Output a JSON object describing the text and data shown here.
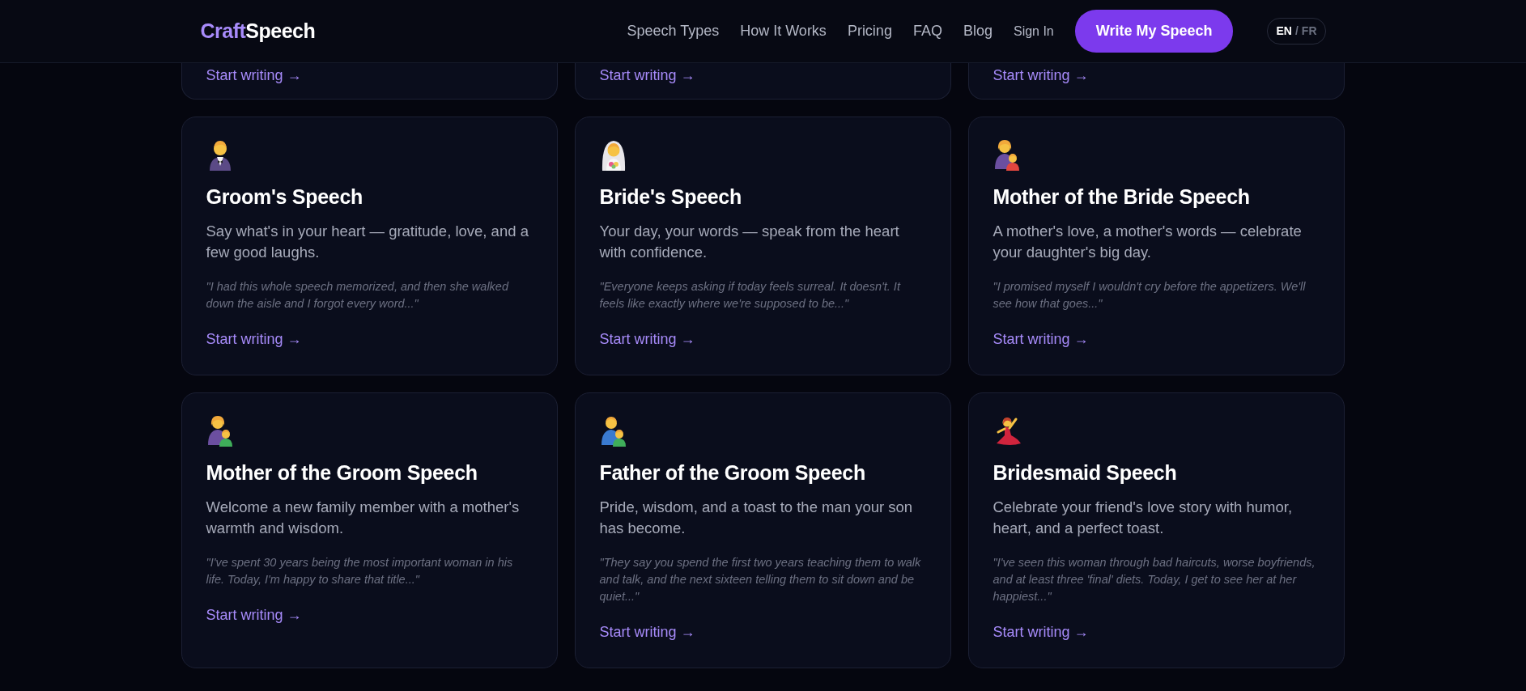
{
  "header": {
    "logo": {
      "accent": "Craft",
      "rest": "Speech"
    },
    "nav_links": [
      "Speech Types",
      "How It Works",
      "Pricing",
      "FAQ",
      "Blog"
    ],
    "sign_in": "Sign In",
    "cta": "Write My Speech",
    "language": {
      "options": [
        {
          "label": "EN",
          "selected": true
        },
        {
          "label": "FR",
          "selected": false
        }
      ],
      "separator": "/"
    }
  },
  "partial_cards": [
    {
      "link": "Start writing →"
    },
    {
      "link": "Start writing →"
    },
    {
      "link": "Start writing →"
    }
  ],
  "cards": [
    {
      "title": "Groom's Speech",
      "description": "Say what's in your heart — gratitude, love, and a few good laughs.",
      "quote": "\"I had this whole speech memorized, and then she walked down the aisle and I forgot every word...\"",
      "link": "Start writing →"
    },
    {
      "title": "Bride's Speech",
      "description": "Your day, your words — speak from the heart with confidence.",
      "quote": "\"Everyone keeps asking if today feels surreal. It doesn't. It feels like exactly where we're supposed to be...\"",
      "link": "Start writing →"
    },
    {
      "title": "Mother of the Bride Speech",
      "description": "A mother's love, a mother's words — celebrate your daughter's big day.",
      "quote": "\"I promised myself I wouldn't cry before the appetizers. We'll see how that goes...\"",
      "link": "Start writing →"
    },
    {
      "title": "Mother of the Groom Speech",
      "description": "Welcome a new family member with a mother's warmth and wisdom.",
      "quote": "\"I've spent 30 years being the most important woman in his life. Today, I'm happy to share that title...\"",
      "link": "Start writing →"
    },
    {
      "title": "Father of the Groom Speech",
      "description": "Pride, wisdom, and a toast to the man your son has become.",
      "quote": "\"They say you spend the first two years teaching them to walk and talk, and the next sixteen telling them to sit down and be quiet...\"",
      "link": "Start writing →"
    },
    {
      "title": "Bridesmaid Speech",
      "description": "Celebrate your friend's love story with humor, heart, and a perfect toast.",
      "quote": "\"I've seen this woman through bad haircuts, worse boyfriends, and at least three 'final' diets. Today, I get to see her at her happiest...\"",
      "link": "Start writing →"
    }
  ]
}
